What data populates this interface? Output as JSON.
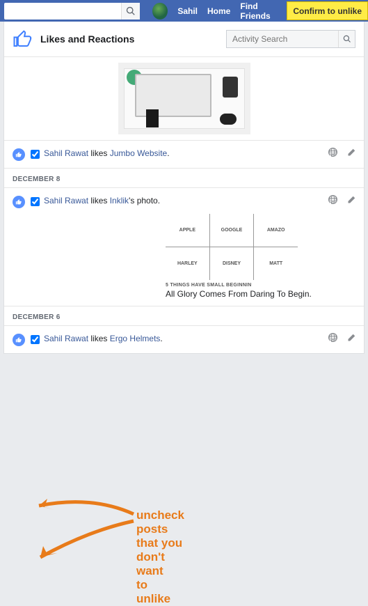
{
  "topbar": {
    "search_placeholder": "",
    "user_name": "Sahil",
    "home": "Home",
    "find_friends": "Find Friends",
    "confirm_btn": "Confirm to unlike"
  },
  "header": {
    "title": "Likes and Reactions",
    "activity_search_placeholder": "Activity Search"
  },
  "entries": [
    {
      "user": "Sahil Rawat",
      "verb": " likes ",
      "target": "Jumbo Website",
      "suffix": "."
    },
    {
      "user": "Sahil Rawat",
      "verb": " likes ",
      "target": "Inklik",
      "suffix": "'s photo."
    },
    {
      "user": "Sahil Rawat",
      "verb": " likes ",
      "target": "Ergo Helmets",
      "suffix": "."
    }
  ],
  "dates": {
    "dec8": "DECEMBER 8",
    "dec6": "DECEMBER 6"
  },
  "grid_labels": [
    "APPLE",
    "GOOGLE",
    "AMAZO",
    "HARLEY",
    "DISNEY",
    "MATT"
  ],
  "captions": {
    "small": "5 THINGS HAVE SMALL BEGINNIN",
    "main": "All Glory Comes From Daring To Begin."
  },
  "annotation": {
    "line1": "uncheck posts",
    "line2": "that you don't want",
    "line3": "to unlike"
  },
  "colors": {
    "accent": "#e87b1a",
    "fb_blue": "#4267b2",
    "link": "#385898"
  }
}
